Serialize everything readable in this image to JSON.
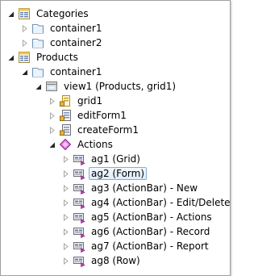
{
  "tree": {
    "nodes": [
      {
        "name": "node-categories",
        "label": "Categories",
        "depth": 0,
        "toggle": "expanded",
        "icon": "page-icon"
      },
      {
        "name": "node-categories-container1",
        "label": "container1",
        "depth": 1,
        "toggle": "collapsed",
        "icon": "container-icon"
      },
      {
        "name": "node-categories-container2",
        "label": "container2",
        "depth": 1,
        "toggle": "collapsed",
        "icon": "container-icon"
      },
      {
        "name": "node-products",
        "label": "Products",
        "depth": 0,
        "toggle": "expanded",
        "icon": "page-icon"
      },
      {
        "name": "node-products-container1",
        "label": "container1",
        "depth": 1,
        "toggle": "expanded",
        "icon": "container-icon"
      },
      {
        "name": "node-view1",
        "label": "view1 (Products, grid1)",
        "depth": 2,
        "toggle": "expanded",
        "icon": "view-icon"
      },
      {
        "name": "node-grid1",
        "label": "grid1",
        "depth": 3,
        "toggle": "collapsed",
        "icon": "grid-view-icon"
      },
      {
        "name": "node-editform1",
        "label": "editForm1",
        "depth": 3,
        "toggle": "collapsed",
        "icon": "form-view-icon"
      },
      {
        "name": "node-createform1",
        "label": "createForm1",
        "depth": 3,
        "toggle": "collapsed",
        "icon": "form-view-icon"
      },
      {
        "name": "node-actions",
        "label": "Actions",
        "depth": 3,
        "toggle": "expanded",
        "icon": "actions-icon"
      },
      {
        "name": "node-ag1",
        "label": "ag1 (Grid)",
        "depth": 4,
        "toggle": "collapsed",
        "icon": "action-group-icon"
      },
      {
        "name": "node-ag2",
        "label": "ag2 (Form)",
        "depth": 4,
        "toggle": "collapsed",
        "icon": "action-group-icon",
        "selected": true
      },
      {
        "name": "node-ag3",
        "label": "ag3 (ActionBar) - New",
        "depth": 4,
        "toggle": "collapsed",
        "icon": "action-group-icon"
      },
      {
        "name": "node-ag4",
        "label": "ag4 (ActionBar) - Edit/Delete",
        "depth": 4,
        "toggle": "collapsed",
        "icon": "action-group-icon"
      },
      {
        "name": "node-ag5",
        "label": "ag5 (ActionBar) - Actions",
        "depth": 4,
        "toggle": "collapsed",
        "icon": "action-group-icon"
      },
      {
        "name": "node-ag6",
        "label": "ag6 (ActionBar) - Record",
        "depth": 4,
        "toggle": "collapsed",
        "icon": "action-group-icon"
      },
      {
        "name": "node-ag7",
        "label": "ag7 (ActionBar) - Report",
        "depth": 4,
        "toggle": "collapsed",
        "icon": "action-group-icon"
      },
      {
        "name": "node-ag8",
        "label": "ag8 (Row)",
        "depth": 4,
        "toggle": "collapsed",
        "icon": "action-group-icon"
      }
    ]
  },
  "colors": {
    "selection_border": "#84acdd",
    "selection_fill": "#dcecfc",
    "toggle_expanded": "#262626",
    "toggle_collapsed": "#a6a6a6",
    "actions_accent": "#c13fc1"
  }
}
